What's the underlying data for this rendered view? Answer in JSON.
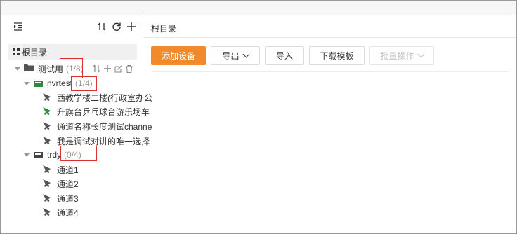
{
  "sidebar": {
    "root_label": "根目录",
    "tree": {
      "group": {
        "name": "测试用",
        "count": "(1/8)"
      },
      "nvr1": {
        "name": "nvrtest",
        "count": "(1/4)"
      },
      "nvr1_channels": [
        "西教学楼二楼(行政室办公",
        "升旗台乒乓球台游乐场车",
        "通道名称长度测试channe",
        "我是调试对讲的唯一选择"
      ],
      "nvr2": {
        "name": "trdy",
        "count": "(0/4)"
      },
      "nvr2_channels": [
        "通道1",
        "通道2",
        "通道3",
        "通道4"
      ]
    }
  },
  "main": {
    "breadcrumb": "根目录",
    "buttons": {
      "add": "添加设备",
      "export": "导出",
      "import": "导入",
      "template": "下载模板",
      "batch": "批量操作"
    }
  },
  "colors": {
    "primary": "#f08a2a",
    "online": "#2e8b3e",
    "highlight": "#e02e2e"
  }
}
